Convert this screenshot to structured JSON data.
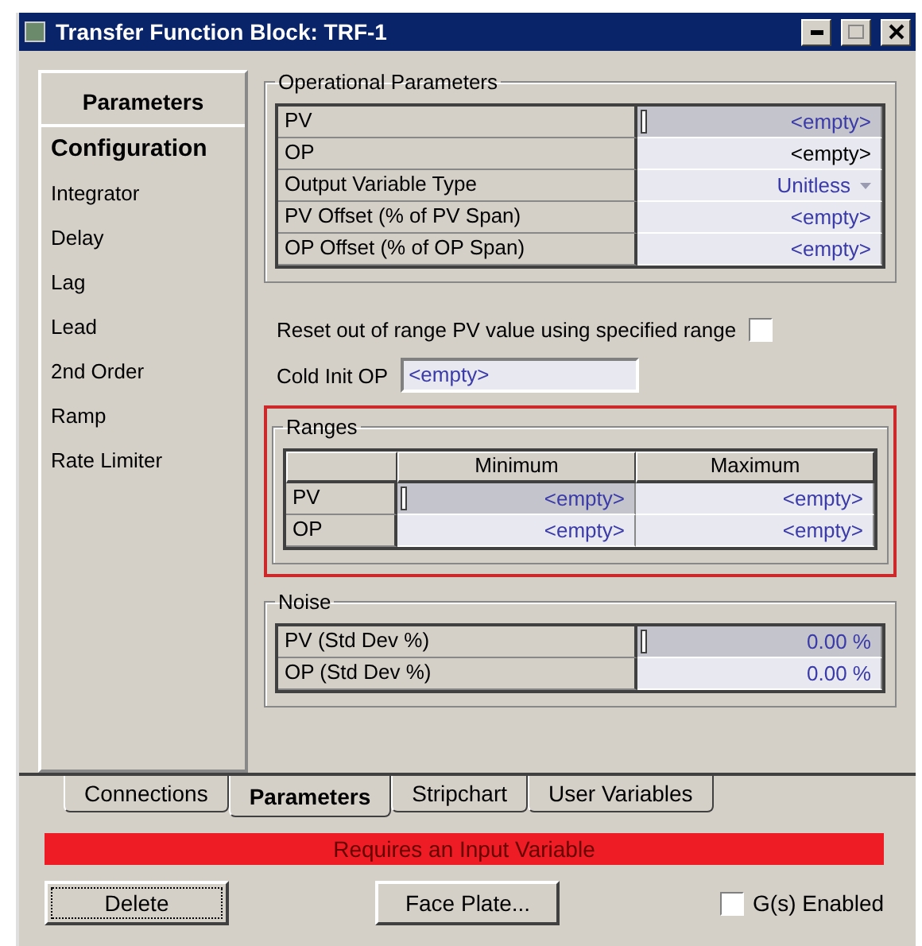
{
  "window": {
    "title": "Transfer Function Block: TRF-1"
  },
  "sidebar": {
    "title": "Parameters",
    "items": [
      {
        "label": "Configuration",
        "selected": true
      },
      {
        "label": "Integrator",
        "selected": false
      },
      {
        "label": "Delay",
        "selected": false
      },
      {
        "label": "Lag",
        "selected": false
      },
      {
        "label": "Lead",
        "selected": false
      },
      {
        "label": "2nd Order",
        "selected": false
      },
      {
        "label": "Ramp",
        "selected": false
      },
      {
        "label": "Rate Limiter",
        "selected": false
      }
    ]
  },
  "operational_parameters": {
    "title": "Operational Parameters",
    "rows": [
      {
        "label": "PV",
        "value": "<empty>",
        "selected": true,
        "kind": "text",
        "color": "#3a3aa8"
      },
      {
        "label": "OP",
        "value": "<empty>",
        "selected": false,
        "kind": "text",
        "color": "#000000"
      },
      {
        "label": "Output Variable Type",
        "value": "Unitless",
        "selected": false,
        "kind": "dropdown",
        "color": "#3a3aa8"
      },
      {
        "label": "PV Offset (% of PV Span)",
        "value": "<empty>",
        "selected": false,
        "kind": "text",
        "color": "#3a3aa8"
      },
      {
        "label": "OP Offset (% of OP Span)",
        "value": "<empty>",
        "selected": false,
        "kind": "text",
        "color": "#3a3aa8"
      }
    ]
  },
  "reset_option": {
    "label": "Reset out of range PV value using specified range",
    "checked": false
  },
  "cold_init_op": {
    "label": "Cold Init OP",
    "value": "<empty>"
  },
  "ranges": {
    "title": "Ranges",
    "highlighted": true,
    "columns": [
      "Minimum",
      "Maximum"
    ],
    "rows": [
      {
        "label": "PV",
        "selected": true,
        "cells": [
          "<empty>",
          "<empty>"
        ]
      },
      {
        "label": "OP",
        "selected": false,
        "cells": [
          "<empty>",
          "<empty>"
        ]
      }
    ]
  },
  "noise": {
    "title": "Noise",
    "rows": [
      {
        "label": "PV (Std Dev %)",
        "value": "0.00 %",
        "selected": true
      },
      {
        "label": "OP (Std Dev %)",
        "value": "0.00 %",
        "selected": false
      }
    ]
  },
  "tabs": [
    {
      "label": "Connections",
      "selected": false
    },
    {
      "label": "Parameters",
      "selected": true
    },
    {
      "label": "Stripchart",
      "selected": false
    },
    {
      "label": "User Variables",
      "selected": false
    }
  ],
  "status_message": "Requires an Input Variable",
  "buttons": {
    "delete": "Delete",
    "face_plate": "Face Plate..."
  },
  "gs_enabled": {
    "label": "G(s) Enabled",
    "checked": false
  }
}
